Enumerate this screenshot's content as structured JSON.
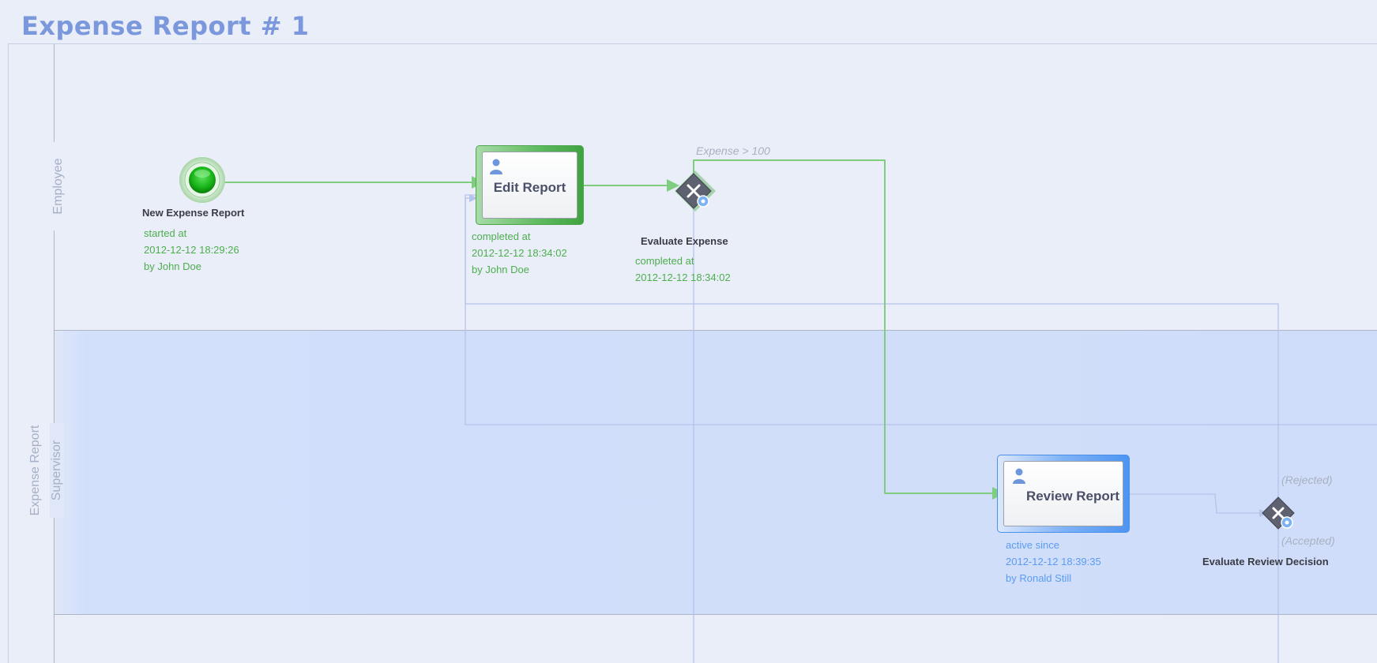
{
  "title": "Expense Report # 1",
  "colors": {
    "completed_flow": "#7fcd7f",
    "inactive_flow": "#b6c3ea",
    "completed_text": "#4eae4e",
    "active_text": "#5b9cf0",
    "title": "#7b98dc"
  },
  "lanes": {
    "employee": "Employee",
    "supervisor_line1": "Expense Report",
    "supervisor_line2": "Supervisor"
  },
  "start_event": {
    "label": "New Expense Report",
    "status": [
      "started at",
      "2012-12-12 18:29:26",
      "by John Doe"
    ]
  },
  "edit_task": {
    "label": "Edit Report",
    "icon": "user-icon",
    "status": [
      "completed at",
      "2012-12-12 18:34:02",
      "by John Doe"
    ]
  },
  "evaluate_gateway": {
    "label": "Evaluate Expense",
    "icon": "exclusive-gateway-icon",
    "status": [
      "completed at",
      "2012-12-12 18:34:02"
    ]
  },
  "review_task": {
    "label": "Review Report",
    "icon": "user-icon",
    "status": [
      "active since",
      "2012-12-12 18:39:35",
      "by Ronald Still"
    ]
  },
  "review_gateway": {
    "label": "Evaluate Review Decision",
    "icon": "exclusive-gateway-icon"
  },
  "conditions": {
    "expense": "Expense > 100",
    "rejected": "(Rejected)",
    "accepted": "(Accepted)"
  }
}
